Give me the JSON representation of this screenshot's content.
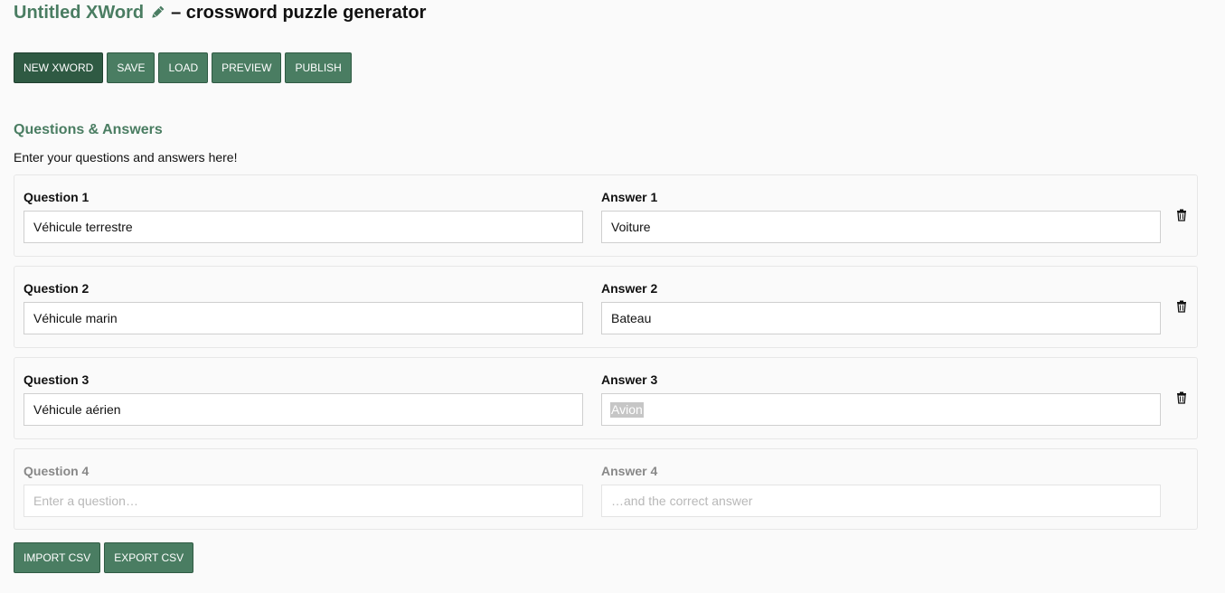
{
  "header": {
    "title_name": "Untitled XWord",
    "title_rest": "– crossword puzzle generator"
  },
  "toolbar": {
    "new_label": "NEW XWORD",
    "save_label": "SAVE",
    "load_label": "LOAD",
    "preview_label": "PREVIEW",
    "publish_label": "PUBLISH"
  },
  "section": {
    "title": "Questions & Answers",
    "description": "Enter your questions and answers here!"
  },
  "qa": [
    {
      "q_label": "Question 1",
      "q_value": "Véhicule terrestre",
      "a_label": "Answer 1",
      "a_value": "Voiture"
    },
    {
      "q_label": "Question 2",
      "q_value": "Véhicule marin",
      "a_label": "Answer 2",
      "a_value": "Bateau"
    },
    {
      "q_label": "Question 3",
      "q_value": "Véhicule aérien",
      "a_label": "Answer 3",
      "a_value": "Avion"
    },
    {
      "q_label": "Question 4",
      "q_placeholder": "Enter a question…",
      "a_label": "Answer 4",
      "a_placeholder": "…and the correct answer"
    }
  ],
  "csv": {
    "import_label": "IMPORT CSV",
    "export_label": "EXPORT CSV"
  },
  "colors": {
    "accent": "#4a7d62",
    "accent_dark": "#2f5a43"
  },
  "icons": {
    "edit": "pencil-icon",
    "delete": "trash-icon"
  }
}
